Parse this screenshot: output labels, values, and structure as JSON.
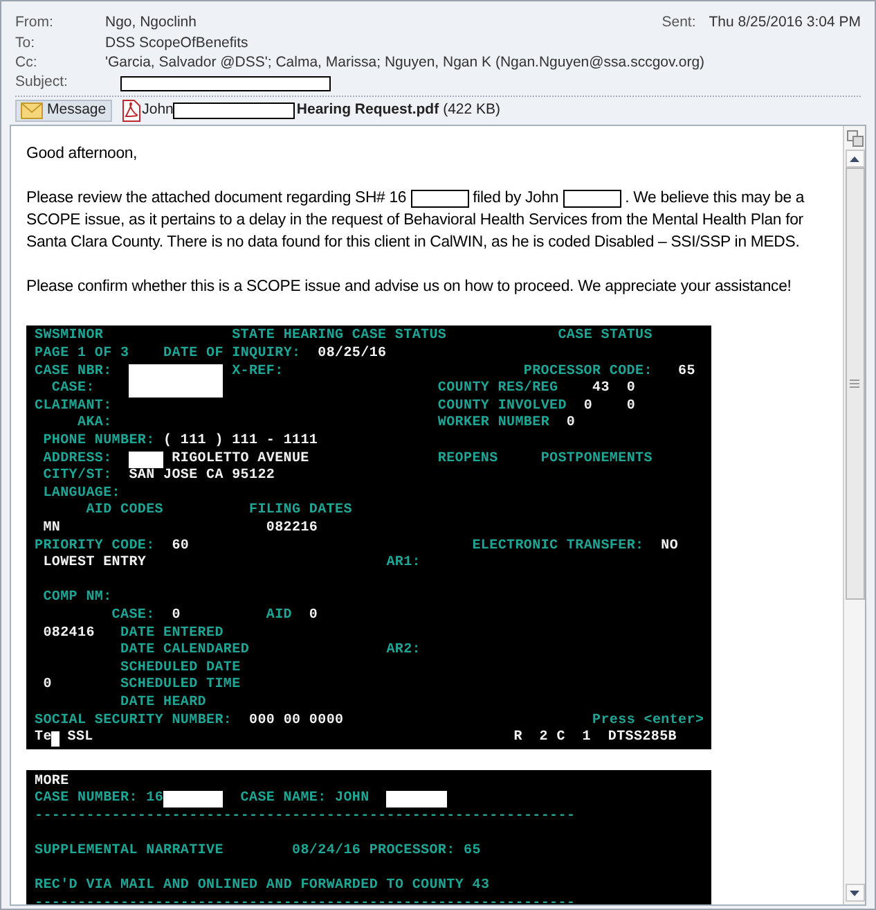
{
  "header": {
    "fields": [
      {
        "label": "From:",
        "value": "Ngo, Ngoclinh"
      },
      {
        "label": "To:",
        "value": "DSS ScopeOfBenefits"
      },
      {
        "label": "Cc:",
        "value": "'Garcia, Salvador @DSS'; Calma, Marissa; Nguyen, Ngan K (Ngan.Nguyen@ssa.sccgov.org)"
      },
      {
        "label": "Subject:",
        "redacted": true
      }
    ],
    "sent": {
      "label": "Sent:",
      "value": "Thu 8/25/2016 3:04 PM"
    }
  },
  "tabs": [
    {
      "kind": "message",
      "label": "Message",
      "selected": true
    },
    {
      "kind": "attachment",
      "name_start": "John",
      "name_end": "Hearing Request.pdf",
      "size": "(422 KB)",
      "selected": false
    }
  ],
  "body": {
    "greeting": "Good afternoon,",
    "paragraphs": [
      [
        {
          "kind": "text",
          "text": "Please review the attached document regarding SH# 16"
        },
        {
          "kind": "redaction"
        },
        {
          "kind": "text",
          "text": "filed by John"
        },
        {
          "kind": "redaction"
        },
        {
          "kind": "text",
          "text": ".  We believe this may be a SCOPE issue, as it pertains to a delay in the request of Behavioral Health Services from the Mental Health Plan for Santa Clara County.  There is no data found for this client in CalWIN, as he is coded Disabled – SSI/SSP in MEDS."
        }
      ],
      [
        {
          "kind": "text",
          "text": "Please confirm whether this is a SCOPE issue and advise us on how to proceed.  We appreciate your assistance!"
        }
      ]
    ]
  },
  "terminals": [
    {
      "lines": [
        [
          {
            "kind": "label",
            "text": "SWSMINOR"
          },
          {
            "kind": "label",
            "text": "STATE HEARING CASE STATUS"
          },
          {
            "kind": "label",
            "text": "CASE STATUS"
          }
        ],
        [
          {
            "kind": "label",
            "text": "PAGE 1 OF 3"
          },
          {
            "kind": "label",
            "text": "DATE OF INQUIRY:"
          },
          {
            "kind": "value",
            "text": "08/25/16"
          }
        ],
        [
          {
            "kind": "label",
            "text": "CASE NBR:"
          },
          {
            "kind": "redaction"
          },
          {
            "kind": "label",
            "text": "X-REF:"
          },
          {
            "kind": "label",
            "text": "PROCESSOR CODE:"
          },
          {
            "kind": "value",
            "text": "65"
          }
        ],
        [
          {
            "kind": "label",
            "text": "CASE:"
          },
          {
            "kind": "redaction"
          },
          {
            "kind": "label",
            "text": "COUNTY RES/REG"
          },
          {
            "kind": "value",
            "text": "43"
          },
          {
            "kind": "value",
            "text": "0"
          }
        ],
        [
          {
            "kind": "label",
            "text": "CLAIMANT:"
          },
          {
            "kind": "label",
            "text": "COUNTY INVOLVED"
          },
          {
            "kind": "value",
            "text": "0"
          },
          {
            "kind": "value",
            "text": "0"
          }
        ],
        [
          {
            "kind": "label",
            "text": "AKA:"
          },
          {
            "kind": "label",
            "text": "WORKER NUMBER"
          },
          {
            "kind": "value",
            "text": "0"
          }
        ],
        [
          {
            "kind": "label",
            "text": "PHONE NUMBER:"
          },
          {
            "kind": "value",
            "text": "( 111 ) 111 - 1111"
          }
        ],
        [
          {
            "kind": "label",
            "text": "ADDRESS:"
          },
          {
            "kind": "redaction"
          },
          {
            "kind": "value",
            "text": "RIGOLETTO AVENUE"
          },
          {
            "kind": "label",
            "text": "REOPENS"
          },
          {
            "kind": "label",
            "text": "POSTPONEMENTS"
          }
        ],
        [
          {
            "kind": "label",
            "text": "CITY/ST:"
          },
          {
            "kind": "value",
            "text": "SAN JOSE CA 95122"
          }
        ],
        [
          {
            "kind": "label",
            "text": "LANGUAGE:"
          }
        ],
        [
          {
            "kind": "label",
            "text": "AID CODES"
          },
          {
            "kind": "label",
            "text": "FILING DATES"
          }
        ],
        [
          {
            "kind": "value",
            "text": "MN"
          },
          {
            "kind": "value",
            "text": "082216"
          }
        ],
        [
          {
            "kind": "label",
            "text": "PRIORITY CODE:"
          },
          {
            "kind": "value",
            "text": "60"
          },
          {
            "kind": "label",
            "text": "ELECTRONIC TRANSFER:"
          },
          {
            "kind": "value",
            "text": "NO"
          }
        ],
        [
          {
            "kind": "value",
            "text": "LOWEST ENTRY"
          },
          {
            "kind": "label",
            "text": "AR1:"
          }
        ],
        [
          {
            "kind": "label",
            "text": "COMP NM:"
          }
        ],
        [
          {
            "kind": "label",
            "text": "CASE:"
          },
          {
            "kind": "value",
            "text": "0"
          },
          {
            "kind": "label",
            "text": "AID"
          },
          {
            "kind": "value",
            "text": "0"
          }
        ],
        [
          {
            "kind": "value",
            "text": "082416"
          },
          {
            "kind": "label",
            "text": "DATE ENTERED"
          }
        ],
        [
          {
            "kind": "label",
            "text": "DATE CALENDARED"
          },
          {
            "kind": "label",
            "text": "AR2:"
          }
        ],
        [
          {
            "kind": "label",
            "text": "SCHEDULED DATE"
          }
        ],
        [
          {
            "kind": "value",
            "text": "0"
          },
          {
            "kind": "label",
            "text": "SCHEDULED TIME"
          }
        ],
        [
          {
            "kind": "label",
            "text": "DATE HEARD"
          }
        ],
        [
          {
            "kind": "label",
            "text": "SOCIAL SECURITY NUMBER:"
          },
          {
            "kind": "value",
            "text": "000 00 0000"
          },
          {
            "kind": "label",
            "text": "Press <enter>"
          }
        ],
        [
          {
            "kind": "value",
            "text": "Te"
          },
          {
            "kind": "cursor"
          },
          {
            "kind": "value",
            "text": "SSL"
          },
          {
            "kind": "value",
            "text": "R  2 C  1  DTSS285B"
          }
        ]
      ]
    },
    {
      "lines": [
        [
          {
            "kind": "value",
            "text": "MORE"
          }
        ],
        [
          {
            "kind": "label",
            "text": "CASE NUMBER: 16"
          },
          {
            "kind": "redaction"
          },
          {
            "kind": "label",
            "text": "CASE NAME: JOHN"
          },
          {
            "kind": "redaction"
          }
        ],
        [
          {
            "kind": "label",
            "text": "---------------------------------------------------------------"
          }
        ],
        [
          {
            "kind": "label",
            "text": "SUPPLEMENTAL NARRATIVE"
          },
          {
            "kind": "label",
            "text": "08/24/16 PROCESSOR: 65"
          }
        ],
        [
          {
            "kind": "label",
            "text": "REC'D VIA MAIL AND ONLINED AND FORWARDED TO COUNTY 43"
          }
        ],
        [
          {
            "kind": "label",
            "text": "---------------------------------------------------------------"
          }
        ]
      ]
    }
  ]
}
